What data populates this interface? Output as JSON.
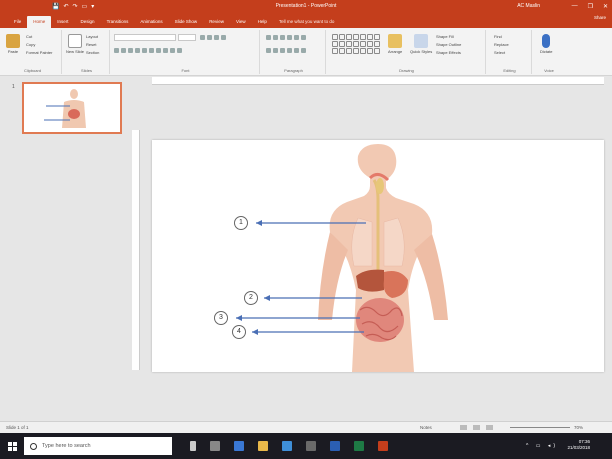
{
  "window": {
    "title": "Presentation1 - PowerPoint",
    "user": "AC Maslin",
    "quick_access": [
      "💾",
      "↶",
      "↷",
      "▭",
      "▾"
    ],
    "buttons": [
      "—",
      "❐",
      "✕"
    ]
  },
  "tabs": [
    "File",
    "Home",
    "Insert",
    "Design",
    "Transitions",
    "Animations",
    "Slide Show",
    "Review",
    "View",
    "Help"
  ],
  "tell_me": "Tell me what you want to do",
  "share_label": "Share",
  "ribbon": {
    "clipboard": {
      "paste": "Paste",
      "cut": "Cut",
      "copy": "Copy",
      "format_painter": "Format Painter",
      "label": "Clipboard"
    },
    "slides": {
      "new_slide": "New Slide",
      "layout": "Layout",
      "reset": "Reset",
      "section": "Section",
      "label": "Slides"
    },
    "font": {
      "label": "Font"
    },
    "paragraph": {
      "label": "Paragraph"
    },
    "drawing": {
      "arrange": "Arrange",
      "quick_styles": "Quick Styles",
      "shape_fill": "Shape Fill",
      "shape_outline": "Shape Outline",
      "shape_effects": "Shape Effects",
      "label": "Drawing"
    },
    "editing": {
      "find": "Find",
      "replace": "Replace",
      "select": "Select",
      "label": "Editing"
    },
    "voice": {
      "dictate": "Dictate",
      "label": "Voice"
    }
  },
  "thumbnail": {
    "number": "1"
  },
  "slide_labels": [
    "1",
    "2",
    "3",
    "4"
  ],
  "status": {
    "slide_of": "Slide 1 of 1",
    "notes": "Notes",
    "zoom": "70%"
  },
  "taskbar": {
    "search_placeholder": "Type here to search",
    "time": "07:36",
    "date": "21/03/2018"
  },
  "colors": {
    "accent": "#c43e1c",
    "arrow": "#4a6fb5"
  }
}
